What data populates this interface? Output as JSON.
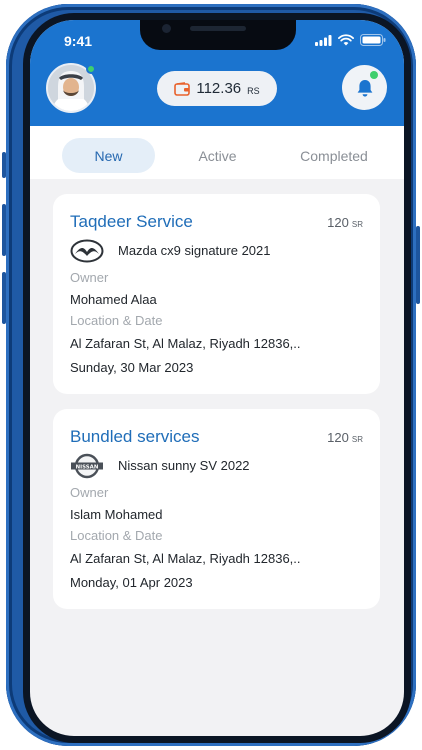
{
  "status_bar": {
    "time": "9:41"
  },
  "wallet": {
    "amount": "112.36",
    "currency": "RS"
  },
  "tabs": [
    {
      "label": "New",
      "active": true
    },
    {
      "label": "Active",
      "active": false
    },
    {
      "label": "Completed",
      "active": false
    }
  ],
  "orders": [
    {
      "title": "Taqdeer Service",
      "price": "120",
      "price_currency": "SR",
      "car": "Mazda cx9 signature 2021",
      "car_logo": "mazda-logo",
      "owner_label": "Owner",
      "owner": "Mohamed Alaa",
      "location_label": "Location & Date",
      "location": "Al Zafaran St, Al Malaz, Riyadh 12836,..",
      "date": "Sunday, 30 Mar 2023"
    },
    {
      "title": "Bundled services",
      "price": "120",
      "price_currency": "SR",
      "car": "Nissan sunny SV 2022",
      "car_logo": "nissan-logo",
      "nissan_logo_text": "NISSAN",
      "owner_label": "Owner",
      "owner": "Islam Mohamed",
      "location_label": "Location & Date",
      "location": "Al Zafaran St, Al Malaz, Riyadh 12836,..",
      "date": "Monday, 01 Apr 2023"
    }
  ],
  "colors": {
    "header": "#1b74cf",
    "accent": "#1f6db8",
    "online": "#3fcf6e",
    "wallet_icon": "#e8622c"
  }
}
